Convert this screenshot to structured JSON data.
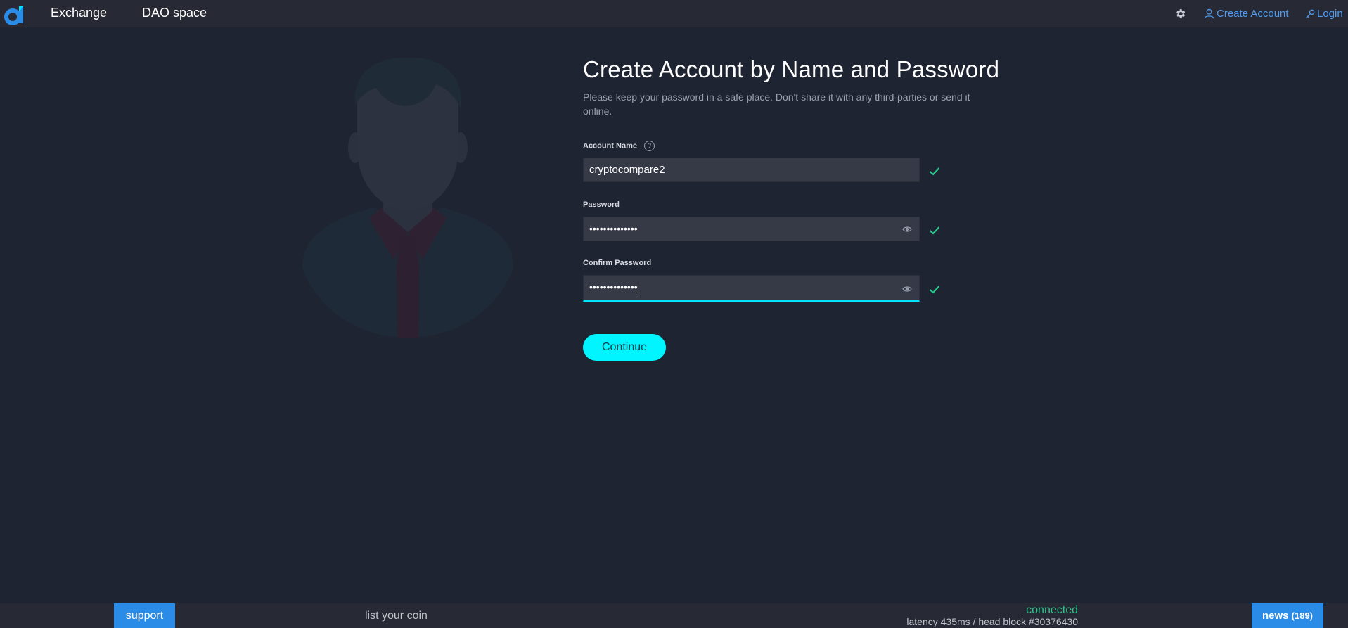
{
  "header": {
    "nav": [
      {
        "label": "Exchange"
      },
      {
        "label": "DAO space"
      }
    ],
    "create_account_label": "Create Account",
    "login_label": "Login",
    "accent_color": "#4f9cf0"
  },
  "form": {
    "title": "Create Account by Name and Password",
    "subtitle": "Please keep your password in a safe place. Don't share it with any third-parties or send it online.",
    "account_name": {
      "label": "Account Name",
      "help": "?",
      "value": "cryptocompare2",
      "valid": true
    },
    "password": {
      "label": "Password",
      "value": "••••••••••••••",
      "valid": true
    },
    "confirm_password": {
      "label": "Confirm Password",
      "value": "••••••••••••••",
      "valid": true
    },
    "continue_label": "Continue",
    "button_color": "#00f5ff",
    "valid_color": "#27c78b"
  },
  "footer": {
    "support_label": "support",
    "list_coin_label": "list your coin",
    "connection_status": "connected",
    "latency_text": "latency 435ms / head block #30376430",
    "news_label": "news",
    "news_count": "(189)"
  },
  "icons": [
    "logo-icon",
    "gear-icon",
    "user-icon",
    "key-icon",
    "help-icon",
    "eye-icon",
    "check-icon"
  ]
}
